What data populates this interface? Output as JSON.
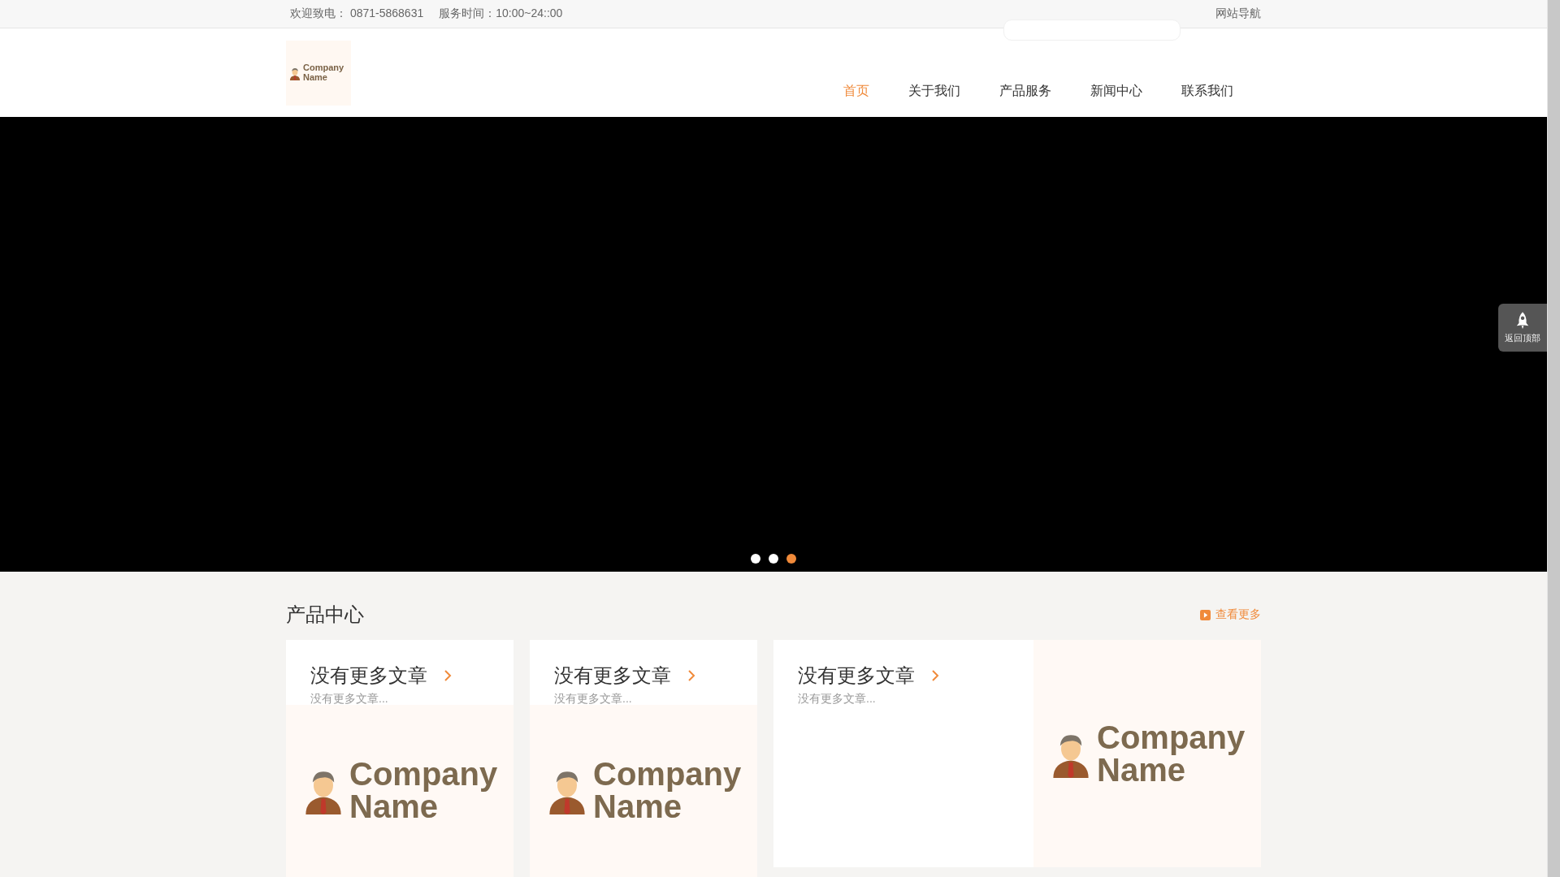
{
  "top_bar": {
    "phone_label": "欢迎致电：",
    "phone": "0871-5868631",
    "hours": "服务时间：10:00~24::00",
    "sitemap": "网站导航"
  },
  "logo": {
    "text": "Company Name"
  },
  "nav": [
    {
      "label": "首页",
      "selected": true
    },
    {
      "label": "关于我们",
      "selected": false
    },
    {
      "label": "产品服务",
      "selected": false
    },
    {
      "label": "新闻中心",
      "selected": false
    },
    {
      "label": "联系我们",
      "selected": false
    }
  ],
  "banner": {
    "dots": [
      {
        "selected": false
      },
      {
        "selected": false
      },
      {
        "selected": true
      }
    ]
  },
  "back_to_top": {
    "label": "返回顶部"
  },
  "products": {
    "title": "产品中心",
    "more": "查看更多",
    "cards": [
      {
        "kind": "stacked",
        "title": "没有更多文章",
        "summary": "没有更多文章...",
        "image_text": "Company Name"
      },
      {
        "kind": "stacked",
        "title": "没有更多文章",
        "summary": "没有更多文章...",
        "image_text": "Company Name"
      },
      {
        "kind": "wide",
        "title": "没有更多文章",
        "summary": "没有更多文章...",
        "image_text": "Company Name"
      }
    ]
  }
}
